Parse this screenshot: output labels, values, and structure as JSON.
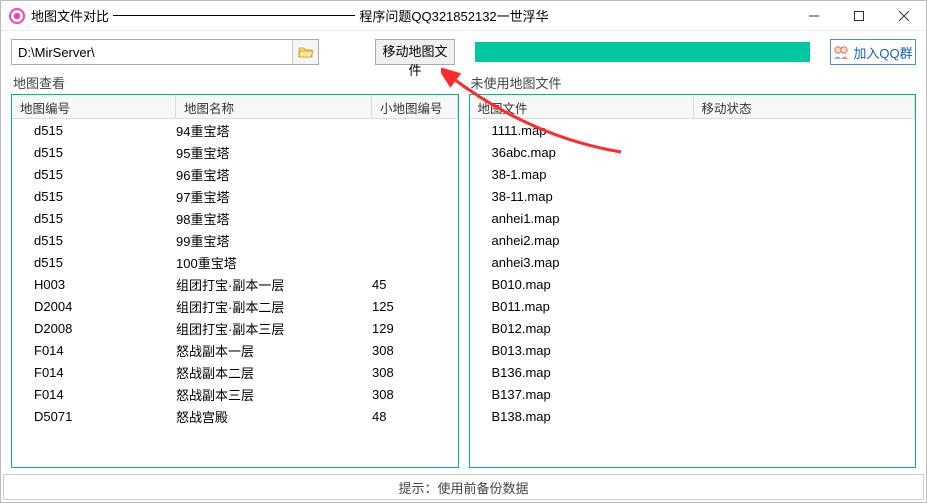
{
  "titlebar": {
    "app_title": "地图文件对比",
    "subtitle": "程序问题QQ321852132一世浮华"
  },
  "toolbar": {
    "path_value": "D:\\MirServer\\",
    "move_button": "移动地图文件",
    "qq_button": "加入QQ群"
  },
  "left_panel": {
    "title": "地图查看",
    "headers": {
      "c1": "地图编号",
      "c2": "地图名称",
      "c3": "小地图编号"
    },
    "rows": [
      {
        "c1": "d515",
        "c2": "94重宝塔",
        "c3": ""
      },
      {
        "c1": "d515",
        "c2": "95重宝塔",
        "c3": ""
      },
      {
        "c1": "d515",
        "c2": "96重宝塔",
        "c3": ""
      },
      {
        "c1": "d515",
        "c2": "97重宝塔",
        "c3": ""
      },
      {
        "c1": "d515",
        "c2": "98重宝塔",
        "c3": ""
      },
      {
        "c1": "d515",
        "c2": "99重宝塔",
        "c3": ""
      },
      {
        "c1": "d515",
        "c2": "100重宝塔",
        "c3": ""
      },
      {
        "c1": "H003",
        "c2": "组团打宝·副本一层",
        "c3": "45"
      },
      {
        "c1": "D2004",
        "c2": "组团打宝·副本二层",
        "c3": "125"
      },
      {
        "c1": "D2008",
        "c2": "组团打宝·副本三层",
        "c3": "129"
      },
      {
        "c1": "F014",
        "c2": "怒战副本一层",
        "c3": "308"
      },
      {
        "c1": "F014",
        "c2": "怒战副本二层",
        "c3": "308"
      },
      {
        "c1": "F014",
        "c2": "怒战副本三层",
        "c3": "308"
      },
      {
        "c1": "D5071",
        "c2": "怒战宫殿",
        "c3": "48"
      }
    ]
  },
  "right_panel": {
    "title": "未使用地图文件",
    "headers": {
      "c1": "地图文件",
      "c2": "移动状态"
    },
    "rows": [
      {
        "c1": "1111.map",
        "c2": ""
      },
      {
        "c1": "36abc.map",
        "c2": ""
      },
      {
        "c1": "38-1.map",
        "c2": ""
      },
      {
        "c1": "38-11.map",
        "c2": ""
      },
      {
        "c1": "anhei1.map",
        "c2": ""
      },
      {
        "c1": "anhei2.map",
        "c2": ""
      },
      {
        "c1": "anhei3.map",
        "c2": ""
      },
      {
        "c1": "B010.map",
        "c2": ""
      },
      {
        "c1": "B011.map",
        "c2": ""
      },
      {
        "c1": "B012.map",
        "c2": ""
      },
      {
        "c1": "B013.map",
        "c2": ""
      },
      {
        "c1": "B136.map",
        "c2": ""
      },
      {
        "c1": "B137.map",
        "c2": ""
      },
      {
        "c1": "B138.map",
        "c2": ""
      }
    ]
  },
  "footer": {
    "hint": "提示：使用前备份数据"
  },
  "colors": {
    "accent": "#02b58a",
    "progress": "#00c8a0"
  }
}
